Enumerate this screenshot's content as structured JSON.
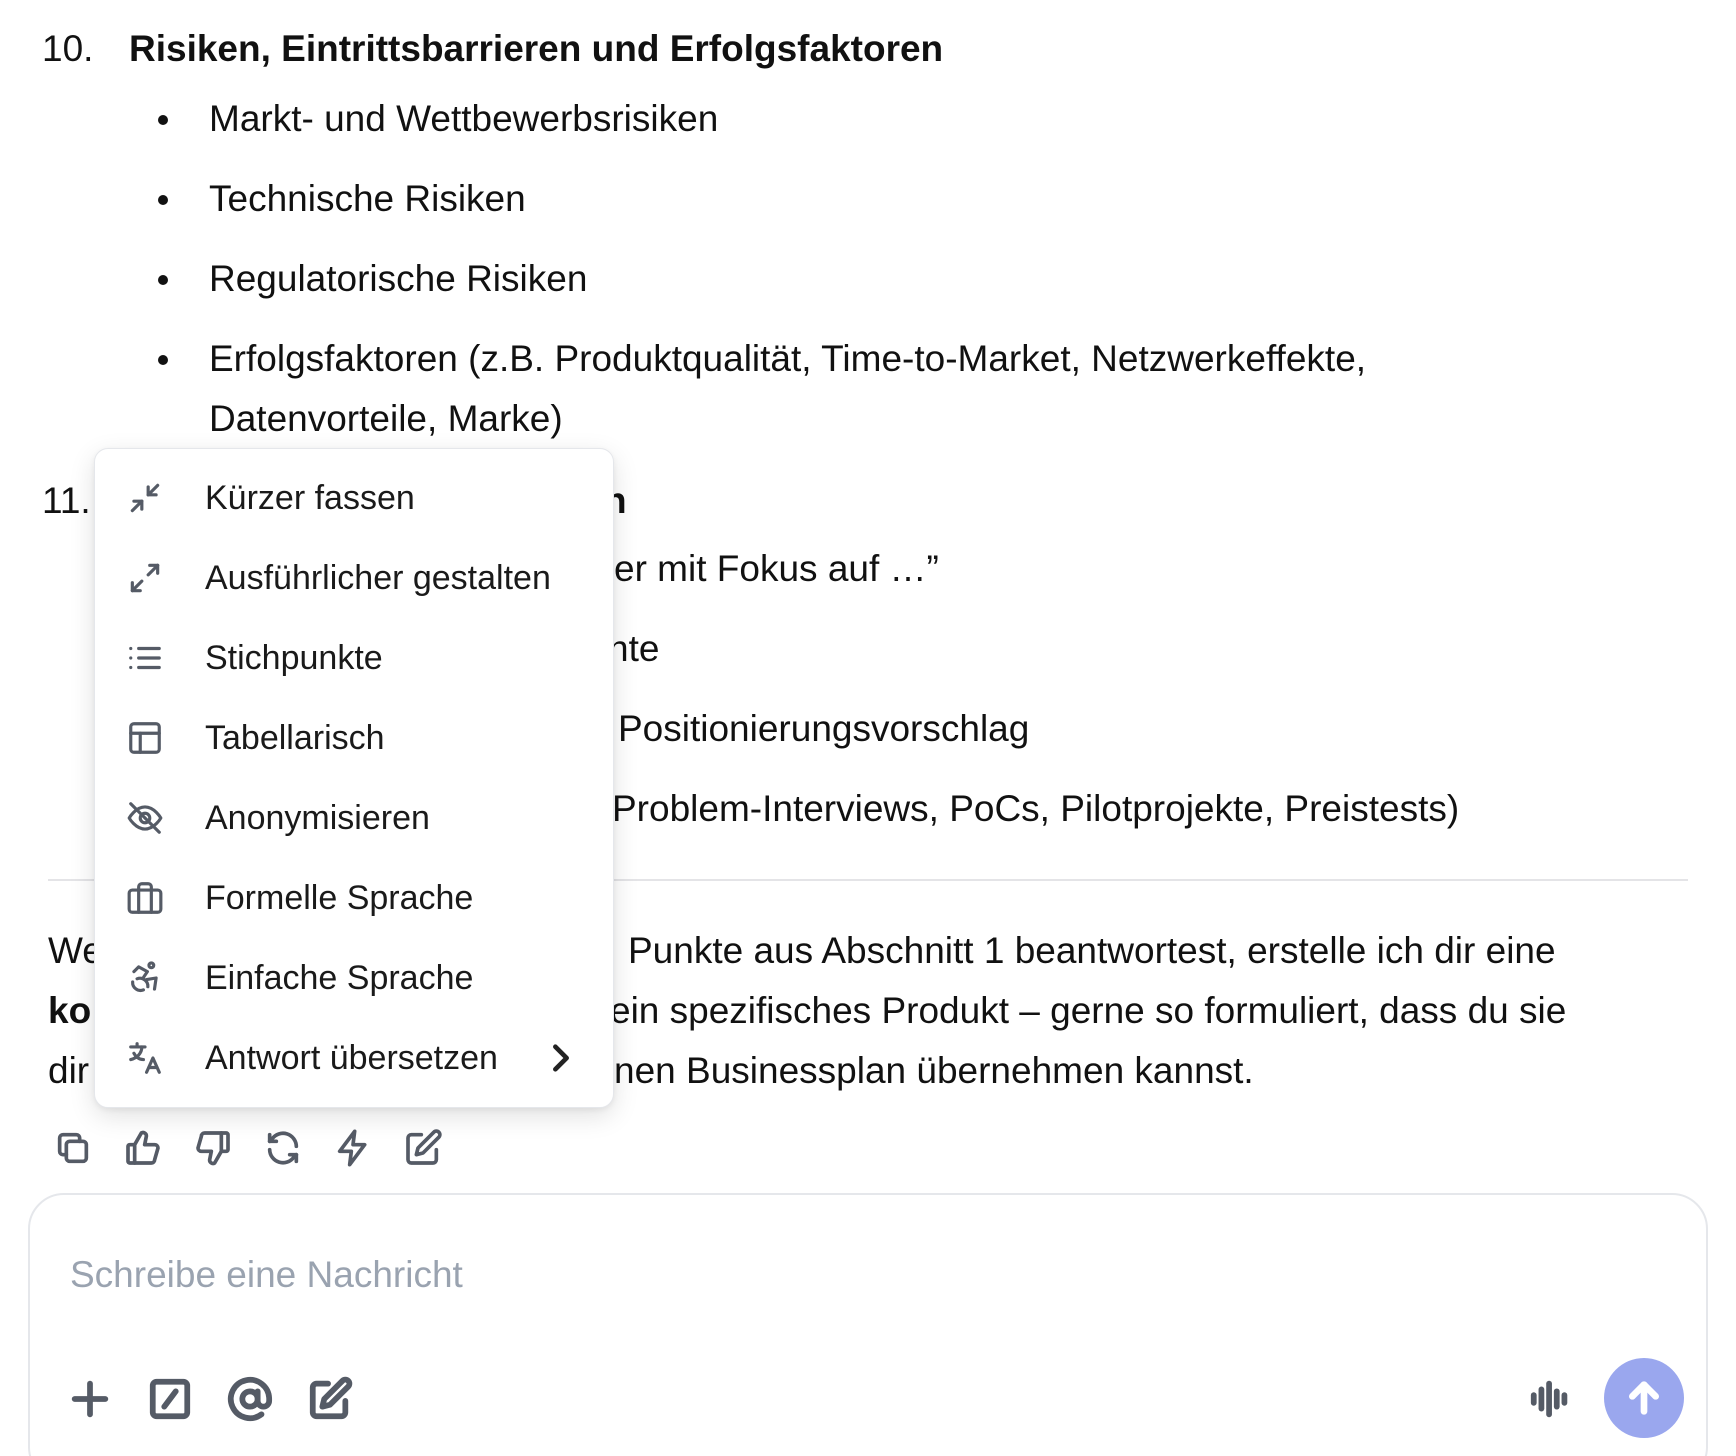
{
  "section10": {
    "number": "10.",
    "title": "Risiken, Eintrittsbarrieren und Erfolgsfaktoren",
    "bullets": [
      "Markt- und Wettbewerbsrisiken",
      "Technische Risiken",
      "Regulatorische Risiken",
      "Erfolgsfaktoren (z.B. Produktqualität, Time-to-Market, Netzwerkeffekte,",
      "Datenvorteile, Marke)"
    ]
  },
  "section11": {
    "number_partial": "11.",
    "title_partial": "n",
    "lines_partial": [
      "er mit Fokus auf …”",
      "nte",
      "Positionierungsvorschlag",
      "Problem-Interviews, PoCs, Pilotprojekte, Preistests)"
    ]
  },
  "closing": {
    "line1_start": "We",
    "line1_end": "Punkte aus Abschnitt 1 beantwortest, erstelle ich dir eine",
    "line2_start": "ko",
    "line2_end": "ein spezifisches Produkt – gerne so formuliert, dass du sie",
    "line3_start": "dir",
    "line3_end": "nen Businessplan übernehmen kannst."
  },
  "menu": {
    "items": [
      {
        "label": "Kürzer fassen",
        "icon": "shrink-icon"
      },
      {
        "label": "Ausführlicher gestalten",
        "icon": "expand-icon"
      },
      {
        "label": "Stichpunkte",
        "icon": "list-icon"
      },
      {
        "label": "Tabellarisch",
        "icon": "table-icon"
      },
      {
        "label": "Anonymisieren",
        "icon": "eye-off-icon"
      },
      {
        "label": "Formelle Sprache",
        "icon": "briefcase-icon"
      },
      {
        "label": "Einfache Sprache",
        "icon": "accessibility-icon"
      },
      {
        "label": "Antwort übersetzen",
        "icon": "translate-icon"
      }
    ]
  },
  "actions": [
    "copy-icon",
    "thumbs-up-icon",
    "thumbs-down-icon",
    "regenerate-icon",
    "bolt-icon",
    "edit-icon"
  ],
  "composer": {
    "placeholder": "Schreibe eine Nachricht"
  },
  "colors": {
    "send_button": "#9aa7ee",
    "placeholder": "#9aa3b0",
    "icon": "#555b66"
  }
}
